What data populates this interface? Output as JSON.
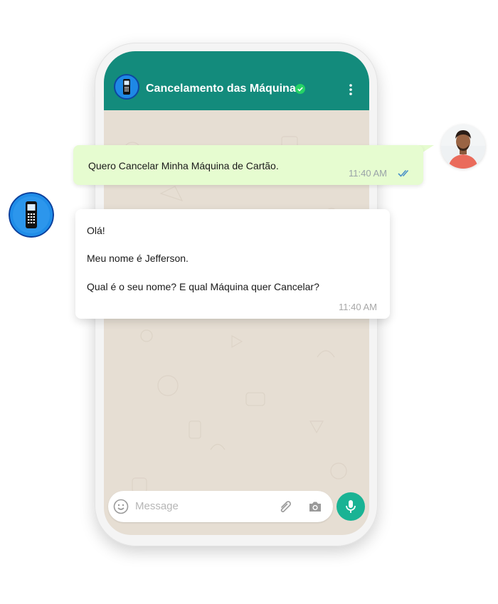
{
  "chat": {
    "contact_name": "Cancelamento das Máquinas",
    "input_placeholder": "Message"
  },
  "messages": [
    {
      "direction": "outgoing",
      "text": "Quero Cancelar Minha Máquina de Cartão.",
      "time": "11:40 AM",
      "status": "read"
    },
    {
      "direction": "incoming",
      "lines": [
        "Olá!",
        "Meu nome é Jefferson.",
        "Qual é o seu nome? E qual Máquina quer Cancelar?"
      ],
      "time": "11:40 AM"
    }
  ],
  "colors": {
    "header": "#138b7c",
    "outgoing_bubble": "#e6fcd0",
    "incoming_bubble": "#ffffff",
    "mic_button": "#1ab394",
    "read_ticks": "#4a90c8",
    "wallpaper": "#e6ded3"
  },
  "icons": [
    "verified-icon",
    "more-icon",
    "emoji-icon",
    "attach-icon",
    "camera-icon",
    "mic-icon",
    "read-ticks-icon",
    "phone-icon"
  ]
}
